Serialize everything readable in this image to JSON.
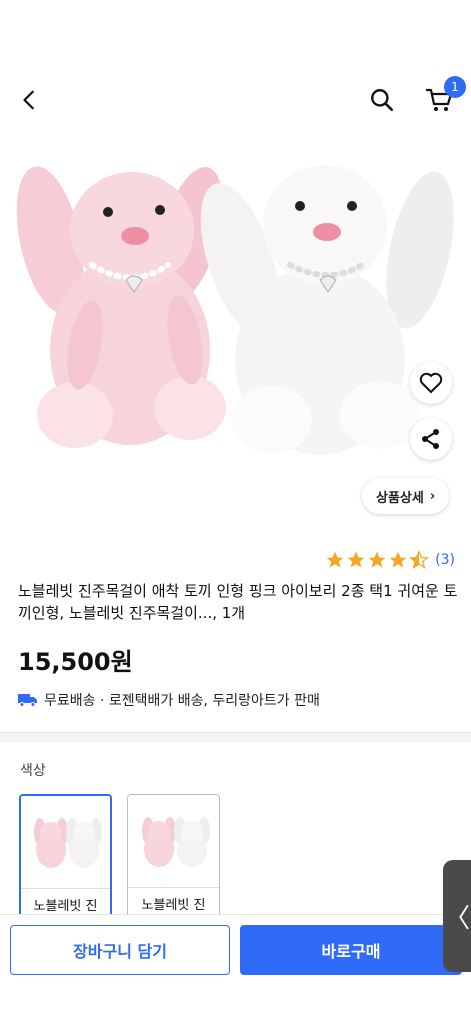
{
  "header": {
    "cart_count": "1",
    "icons": [
      "chevron-left-icon",
      "search-icon",
      "cart-icon"
    ]
  },
  "hero": {
    "detail_label": "상품상세",
    "detail_chevron": "›",
    "icons": [
      "heart-icon",
      "share-icon"
    ]
  },
  "rating": {
    "stars": 4.5,
    "count": "(3)",
    "star_color": "#f5a623"
  },
  "product": {
    "title": "노블레빗 진주목걸이 애착 토끼 인형 핑크 아이보리 2종 택1 귀여운 토끼인형, 노블레빗 진주목걸이..., 1개",
    "price": "15,500원",
    "shipping": "무료배송 · 로젠택배가 배송, 두리랑아트가 판매"
  },
  "options": {
    "label": "색상",
    "items": [
      {
        "name": "노블레빗 진",
        "selected": true
      },
      {
        "name": "노블레빗 진",
        "selected": false
      }
    ]
  },
  "actions": {
    "cart_add": "장바구니 담기",
    "buy_now": "바로구매"
  },
  "side_handle": "〈",
  "colors": {
    "accent": "#2f6bf6",
    "star": "#f5a623"
  }
}
